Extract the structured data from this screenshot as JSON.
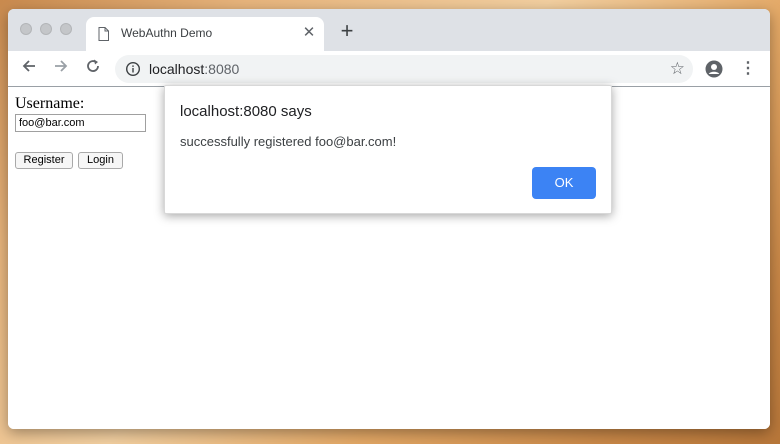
{
  "browser": {
    "tab": {
      "title": "WebAuthn Demo",
      "close_glyph": "✕"
    },
    "new_tab_glyph": "+",
    "address": {
      "host": "localhost",
      "port": ":8080"
    },
    "icons": {
      "back": "arrow-left-icon",
      "forward": "arrow-right-icon",
      "reload": "reload-icon",
      "info": "info-icon",
      "star": "star-icon",
      "account": "account-icon",
      "menu": "more-vert-icon"
    }
  },
  "page": {
    "username_label": "Username:",
    "username_value": "foo@bar.com",
    "register_label": "Register",
    "login_label": "Login"
  },
  "dialog": {
    "title": "localhost:8080 says",
    "message": "successfully registered foo@bar.com!",
    "ok_label": "OK"
  },
  "colors": {
    "accent": "#3c83f4",
    "tabstrip": "#dee1e6",
    "omnibox": "#f1f3f4"
  }
}
